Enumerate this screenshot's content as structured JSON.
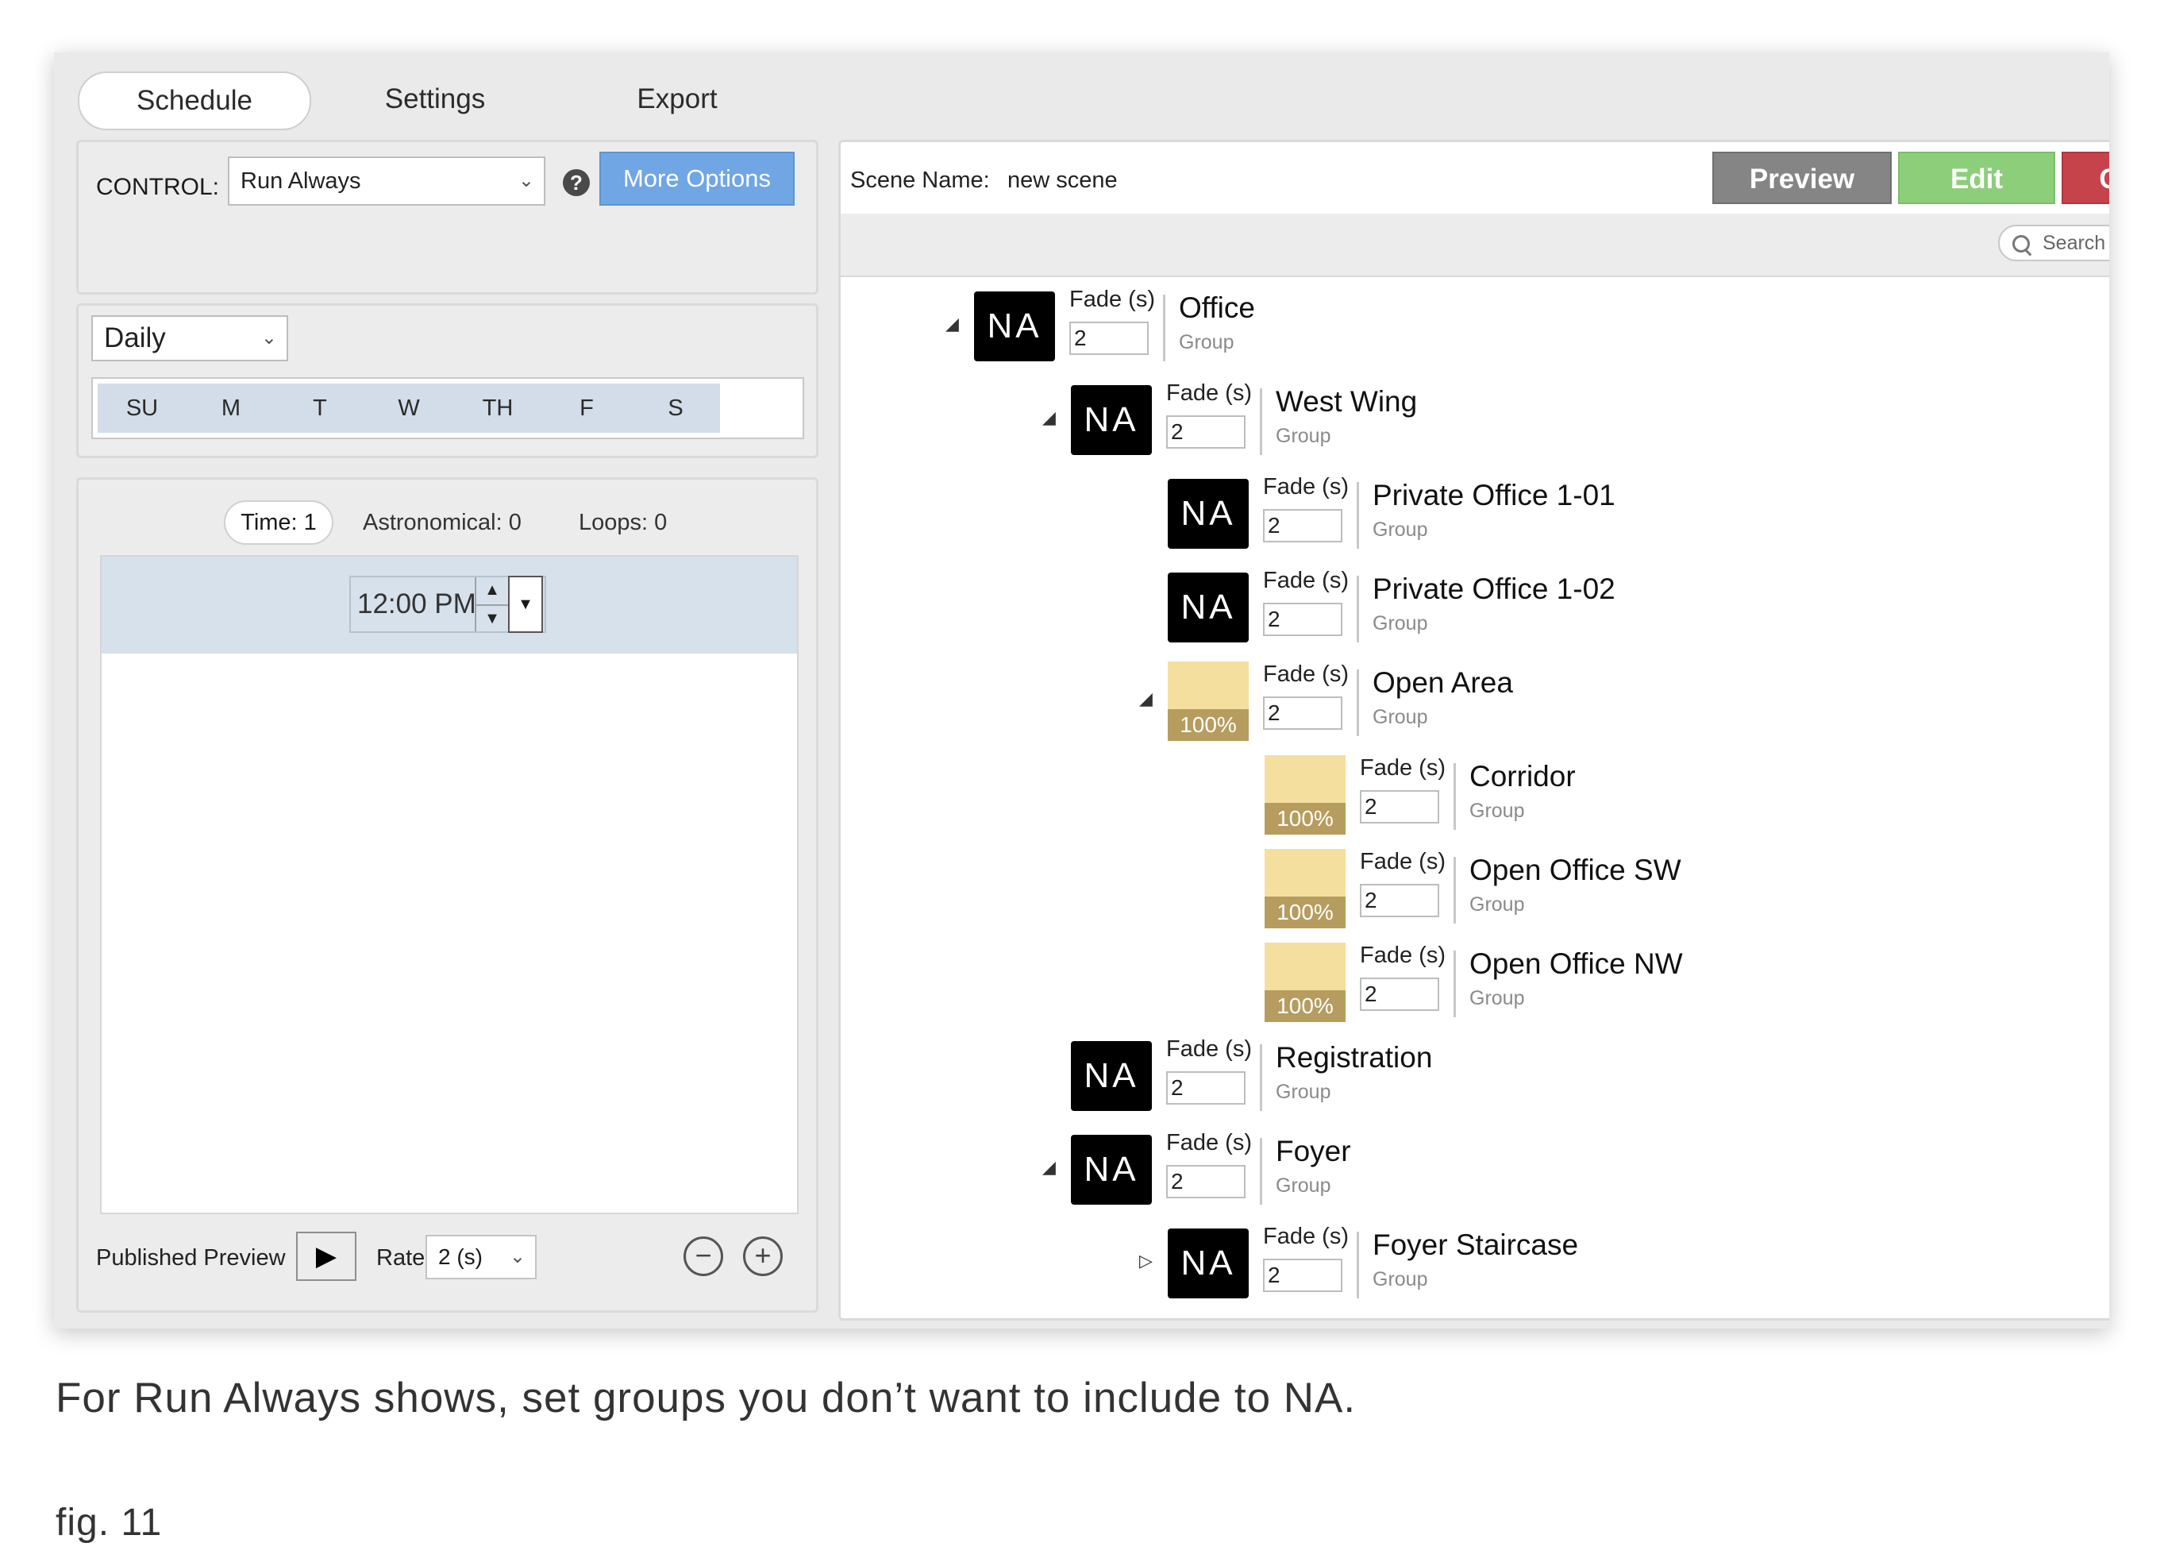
{
  "tabs": [
    "Schedule",
    "Settings",
    "Export"
  ],
  "control": {
    "label": "CONTROL:",
    "value": "Run Always",
    "help_icon": "?",
    "more_options_label": "More Options"
  },
  "repeat": {
    "value": "Daily",
    "days": [
      "SU",
      "M",
      "T",
      "W",
      "TH",
      "F",
      "S"
    ]
  },
  "times": {
    "time_tab": "Time: 1",
    "astronomical": "Astronomical: 0",
    "loops": "Loops: 0",
    "entry_time": "12:00 PM"
  },
  "preview": {
    "label": "Published Preview",
    "rate_label": "Rate",
    "rate_value": "2 (s)"
  },
  "scene": {
    "name_label": "Scene Name:",
    "name_value": "new scene",
    "preview_label": "Preview",
    "edit_label": "Edit",
    "delete_label": "C",
    "search_placeholder": "Search b"
  },
  "groups": [
    {
      "name": "Office",
      "type": "Group",
      "level": "NA",
      "fade_label": "Fade (s)",
      "fade": "2",
      "expander": "open"
    },
    {
      "name": "West Wing",
      "type": "Group",
      "level": "NA",
      "fade_label": "Fade (s)",
      "fade": "2",
      "expander": "open"
    },
    {
      "name": "Private Office 1-01",
      "type": "Group",
      "level": "NA",
      "fade_label": "Fade (s)",
      "fade": "2",
      "expander": "none"
    },
    {
      "name": "Private Office 1-02",
      "type": "Group",
      "level": "NA",
      "fade_label": "Fade (s)",
      "fade": "2",
      "expander": "none"
    },
    {
      "name": "Open Area",
      "type": "Group",
      "level": "100%",
      "fade_label": "Fade (s)",
      "fade": "2",
      "expander": "open"
    },
    {
      "name": "Corridor",
      "type": "Group",
      "level": "100%",
      "fade_label": "Fade (s)",
      "fade": "2",
      "expander": "none"
    },
    {
      "name": "Open Office SW",
      "type": "Group",
      "level": "100%",
      "fade_label": "Fade (s)",
      "fade": "2",
      "expander": "none"
    },
    {
      "name": "Open Office NW",
      "type": "Group",
      "level": "100%",
      "fade_label": "Fade (s)",
      "fade": "2",
      "expander": "none"
    },
    {
      "name": "Registration",
      "type": "Group",
      "level": "NA",
      "fade_label": "Fade (s)",
      "fade": "2",
      "expander": "none"
    },
    {
      "name": "Foyer",
      "type": "Group",
      "level": "NA",
      "fade_label": "Fade (s)",
      "fade": "2",
      "expander": "open"
    },
    {
      "name": "Foyer Staircase",
      "type": "Group",
      "level": "NA",
      "fade_label": "Fade (s)",
      "fade": "2",
      "expander": "closed"
    }
  ],
  "caption": "For Run Always shows, set groups you don’t want to include to NA.",
  "figure_label": "fig. 11",
  "colors": {
    "more_options": "#6fa6e3",
    "preview_button": "#858585",
    "edit_button": "#8dce7b",
    "delete_button": "#c7434b",
    "day_button": "#d2dde9",
    "level_swatch": "#f5df9e",
    "level_band": "#b69c5e"
  }
}
